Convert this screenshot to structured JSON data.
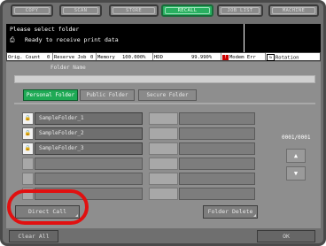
{
  "mode_tabs": [
    {
      "label": "COPY",
      "active": false
    },
    {
      "label": "SCAN",
      "active": false
    },
    {
      "label": "STORE",
      "active": false
    },
    {
      "label": "RECALL",
      "active": true
    },
    {
      "label": "JOB LIST",
      "active": false
    },
    {
      "label": "MACHINE",
      "active": false
    }
  ],
  "message": {
    "title": "Please select folder",
    "printer_icon": "printer-icon",
    "status": "Ready to receive print data"
  },
  "status_bar": {
    "orig_count": "Orig. Count",
    "orig_count_value": "0",
    "reserve_job": "Reserve Job",
    "reserve_job_value": "0",
    "memory": "Memory",
    "memory_value": "100.000%",
    "hdd": "HDD",
    "hdd_value": "99.990%",
    "modem_err": "Modem Err",
    "rotation": "Rotation"
  },
  "folder_name_label": "Folder Name",
  "folder_tabs": [
    {
      "label": "Personal Folder",
      "active": true
    },
    {
      "label": "Public Folder",
      "active": false
    },
    {
      "label": "Secure Folder",
      "active": false
    }
  ],
  "left_folders": [
    {
      "name": "SampleFolder_1",
      "locked": true
    },
    {
      "name": "SampleFolder_2",
      "locked": true
    },
    {
      "name": "SampleFolder_3",
      "locked": true
    },
    {
      "name": "",
      "locked": false
    },
    {
      "name": "",
      "locked": false
    },
    {
      "name": "",
      "locked": false
    }
  ],
  "page_count": "0001/0001",
  "up_arrow": "▲",
  "down_arrow": "▼",
  "direct_call_label": "Direct Call",
  "folder_delete_label": "Folder Delete",
  "clear_all_label": "Clear All",
  "ok_label": "OK",
  "colors": {
    "active_tab": "#28b060",
    "highlight_circle": "#e11010"
  }
}
